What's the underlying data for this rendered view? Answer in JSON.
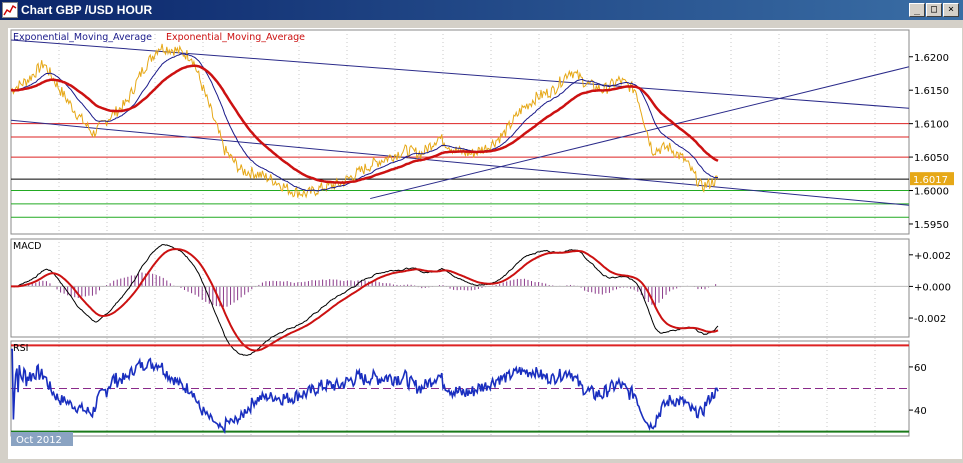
{
  "window": {
    "title": "Chart GBP /USD  HOUR",
    "buttons": [
      "_",
      "□",
      "×"
    ]
  },
  "main_panel": {
    "legend": [
      "Exponential_Moving_Average",
      "Exponential_Moving_Average"
    ],
    "price_badge": "1.6017",
    "ticks": [
      "1.6200",
      "1.6150",
      "1.6100",
      "1.6050",
      "1.6000",
      "1.5950"
    ]
  },
  "macd_panel": {
    "label": "MACD",
    "ticks": [
      "+0.002",
      "+0.000",
      "-0.002"
    ]
  },
  "rsi_panel": {
    "label": "RSI",
    "ticks": [
      "60",
      "40"
    ]
  },
  "period_label": "Oct 2012",
  "colors": {
    "price": "#e6a817",
    "ema_fast": "#1a1a8a",
    "ema_slow": "#cc1111",
    "resistance": "#dd2222",
    "support": "#22aa22",
    "trendline": "#2b2b8a",
    "histogram": "#8a3a8a",
    "rsi": "#1a2fbf"
  },
  "chart_data": [
    {
      "type": "line",
      "title": "Chart GBP /USD  HOUR",
      "series": [
        {
          "name": "Exponential_Moving_Average"
        },
        {
          "name": "Exponential_Moving_Average"
        }
      ],
      "close_profile": [
        1.615,
        1.6165,
        1.619,
        1.615,
        1.6115,
        1.6085,
        1.611,
        1.613,
        1.618,
        1.6215,
        1.621,
        1.62,
        1.613,
        1.606,
        1.603,
        1.6025,
        1.6015,
        1.6,
        1.5995,
        1.6005,
        1.601,
        1.6025,
        1.604,
        1.605,
        1.606,
        1.6055,
        1.608,
        1.606,
        1.6055,
        1.6065,
        1.6085,
        1.612,
        1.614,
        1.615,
        1.618,
        1.616,
        1.615,
        1.6165,
        1.615,
        1.606,
        1.6065,
        1.6045,
        1.6005,
        1.6017
      ],
      "last_price": 1.6017,
      "horizontal_lines": {
        "resistance": [
          1.61,
          1.608,
          1.605
        ],
        "support": [
          1.6,
          1.598,
          1.596
        ]
      },
      "ylim": [
        1.5935,
        1.624
      ]
    },
    {
      "type": "bar",
      "title": "MACD",
      "ylim": [
        -0.0032,
        0.003
      ]
    },
    {
      "type": "line",
      "title": "RSI",
      "levels": [
        70,
        50,
        30
      ],
      "ylim": [
        28,
        72
      ]
    }
  ]
}
